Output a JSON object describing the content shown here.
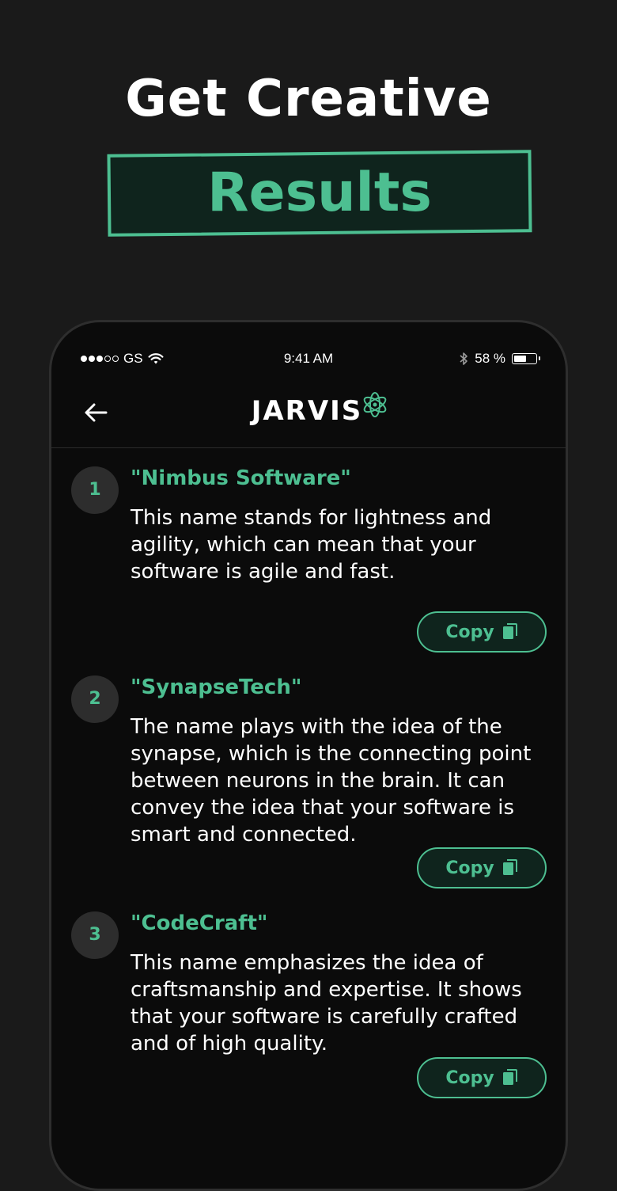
{
  "hero": {
    "title": "Get Creative",
    "highlight": "Results"
  },
  "status_bar": {
    "carrier": "GS",
    "time": "9:41 AM",
    "battery_text": "58 %",
    "battery_level": 0.58,
    "signal_bars_filled": 3,
    "signal_bars_total": 5
  },
  "nav": {
    "brand": "JARVIS",
    "back_icon": "arrow-left-icon",
    "logo_icon": "atom-icon"
  },
  "colors": {
    "accent": "#4dbf91",
    "background": "#1a1a1a",
    "phone_background": "#0b0b0b"
  },
  "results": [
    {
      "number": "1",
      "title": "\"Nimbus Software\"",
      "description": "This name stands for lightness and agility, which can mean that your software is agile and fast.",
      "copy_label": "Copy"
    },
    {
      "number": "2",
      "title": "\"SynapseTech\"",
      "description": "The name plays with the idea of the synapse, which is the connecting point between neurons in the brain. It can convey the idea that your software is smart and connected.",
      "copy_label": "Copy"
    },
    {
      "number": "3",
      "title": "\"CodeCraft\"",
      "description": "This name emphasizes the idea of craftsmanship and expertise. It shows that your software is carefully crafted and of high quality.",
      "copy_label": "Copy"
    }
  ]
}
